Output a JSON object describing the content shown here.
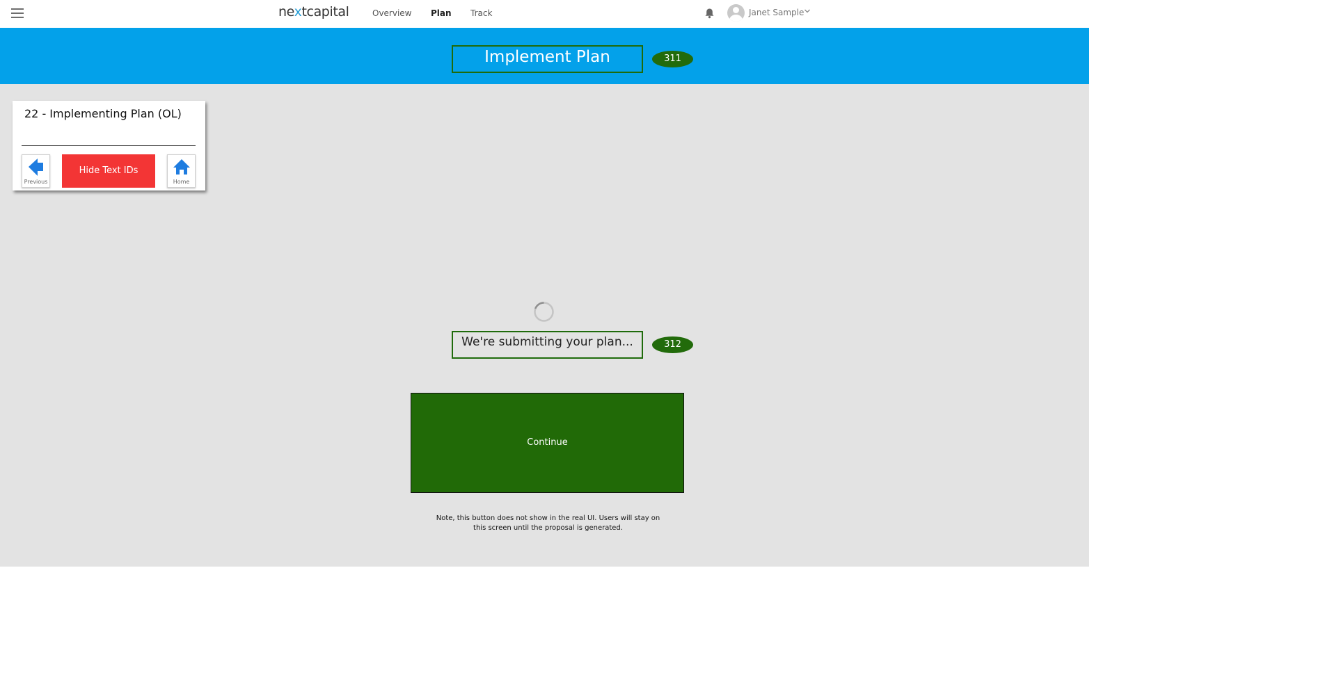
{
  "header": {
    "logo": {
      "pre": "ne",
      "x": "x",
      "post": "tcapital"
    },
    "nav": [
      "Overview",
      "Plan",
      "Track"
    ],
    "active_nav": "Plan",
    "user_name": "Janet Sample"
  },
  "banner": {
    "title": "Implement Plan",
    "title_id": "311"
  },
  "panel": {
    "title": "22 - Implementing Plan (OL)",
    "previous_label": "Previous",
    "toggle_label": "Hide Text IDs",
    "home_label": "Home"
  },
  "main": {
    "status_text": "We're submitting your plan...",
    "status_id": "312",
    "continue_label": "Continue",
    "note": "Note, this button does not show in the real UI. Users will stay on this screen until the proposal is generated."
  },
  "colors": {
    "banner": "#03a1ea",
    "id_badge": "#226b0b",
    "continue": "#216a07",
    "toggle_button": "#f33535",
    "nav_icon_blue": "#1e7ce0"
  },
  "icons": [
    "menu-icon",
    "bell-icon",
    "avatar-icon",
    "chevron-down-icon",
    "arrow-left-icon",
    "home-icon",
    "spinner-icon"
  ]
}
